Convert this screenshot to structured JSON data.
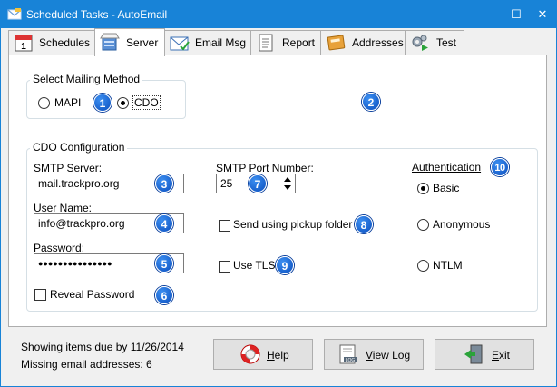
{
  "window": {
    "title": "Scheduled Tasks - AutoEmail",
    "minimize": "—",
    "maximize": "☐",
    "close": "✕"
  },
  "tabs": [
    {
      "label": "Schedules",
      "icon": "calendar-icon",
      "active": false
    },
    {
      "label": "Server",
      "icon": "server-icon",
      "active": true
    },
    {
      "label": "Email Msg",
      "icon": "email-icon",
      "active": false
    },
    {
      "label": "Report",
      "icon": "report-icon",
      "active": false
    },
    {
      "label": "Addresses",
      "icon": "address-book-icon",
      "active": false
    },
    {
      "label": "Test",
      "icon": "gears-play-icon",
      "active": false
    }
  ],
  "mailing_method": {
    "legend": "Select Mailing Method",
    "options": [
      {
        "label": "MAPI",
        "selected": false
      },
      {
        "label": "CDO",
        "selected": true
      }
    ]
  },
  "cdo": {
    "legend": "CDO Configuration",
    "smtp_server_label": "SMTP Server:",
    "smtp_server_value": "mail.trackpro.org",
    "smtp_port_label": "SMTP Port Number:",
    "smtp_port_value": "25",
    "user_name_label": "User Name:",
    "user_name_value": "info@trackpro.org",
    "password_label": "Password:",
    "password_value": "●●●●●●●●●●●●●●●",
    "reveal_password_label": "Reveal Password",
    "reveal_password_checked": false,
    "pickup_folder_label": "Send using pickup folder",
    "pickup_folder_checked": false,
    "use_tls_label": "Use TLS",
    "use_tls_checked": false,
    "authentication_label": "Authentication",
    "auth_options": [
      {
        "label": "Basic",
        "selected": true
      },
      {
        "label": "Anonymous",
        "selected": false
      },
      {
        "label": "NTLM",
        "selected": false
      }
    ]
  },
  "badges": [
    "1",
    "2",
    "3",
    "4",
    "5",
    "6",
    "7",
    "8",
    "9",
    "10"
  ],
  "status": {
    "items_due": "Showing items due by 11/26/2014",
    "missing": "Missing email addresses:  6"
  },
  "buttons": {
    "help": "Help",
    "view_log": "View Log",
    "exit": "Exit"
  },
  "colors": {
    "titlebar": "#1883d7",
    "badge": "#1560d0"
  }
}
